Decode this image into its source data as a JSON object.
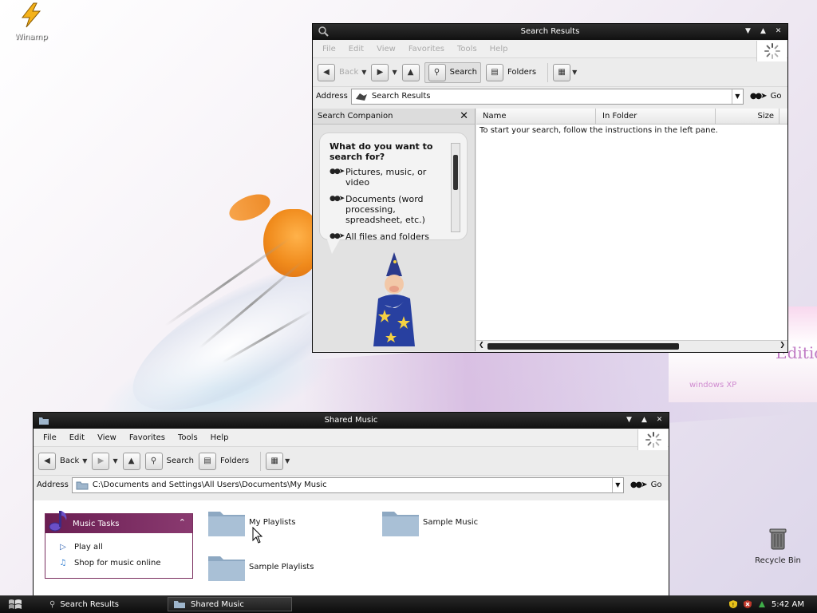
{
  "desktop": {
    "icons": [
      {
        "label": "Winamp"
      },
      {
        "label": "Recycle Bin"
      }
    ],
    "wallpaper_text": {
      "edition": "Edition",
      "small": "windows XP"
    }
  },
  "search_window": {
    "title": "Search Results",
    "menu": [
      "File",
      "Edit",
      "View",
      "Favorites",
      "Tools",
      "Help"
    ],
    "toolbar": {
      "back": "Back",
      "search": "Search",
      "folders": "Folders"
    },
    "address": {
      "label": "Address",
      "value": "Search Results",
      "go": "Go"
    },
    "companion": {
      "title": "Search Companion",
      "question": "What do you want to search for?",
      "options": [
        "Pictures, music, or video",
        "Documents (word processing, spreadsheet, etc.)",
        "All files and folders"
      ]
    },
    "columns": [
      "Name",
      "In Folder",
      "Size"
    ],
    "message": "To start your search, follow the instructions in the left pane."
  },
  "music_window": {
    "title": "Shared Music",
    "menu": [
      "File",
      "Edit",
      "View",
      "Favorites",
      "Tools",
      "Help"
    ],
    "toolbar": {
      "back": "Back",
      "search": "Search",
      "folders": "Folders"
    },
    "address": {
      "label": "Address",
      "value": "C:\\Documents and Settings\\All Users\\Documents\\My Music",
      "go": "Go"
    },
    "tasks": {
      "title": "Music Tasks",
      "items": [
        "Play all",
        "Shop for music online"
      ]
    },
    "folders": [
      "My Playlists",
      "Sample Music",
      "Sample Playlists"
    ]
  },
  "taskbar": {
    "items": [
      "Search Results",
      "Shared Music"
    ],
    "clock": "5:42 AM"
  },
  "colors": {
    "titlebar": "#111111",
    "task_header": "#6a1e52",
    "folder": "#9fb6cc",
    "wall_orange": "#f08b1c"
  }
}
